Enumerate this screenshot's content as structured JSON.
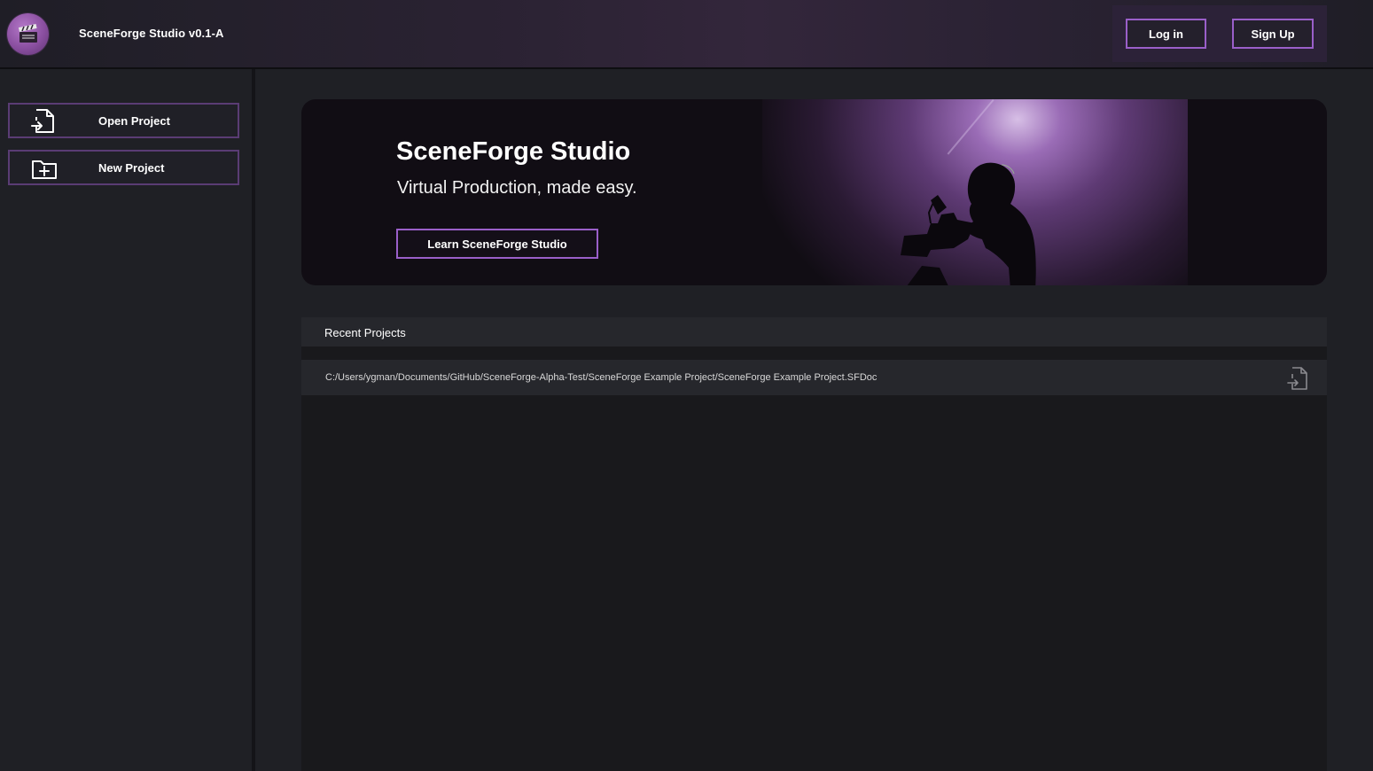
{
  "header": {
    "app_title": "SceneForge Studio v0.1-A",
    "logo_icon": "clapperboard-logo-icon",
    "login_label": "Log in",
    "signup_label": "Sign Up"
  },
  "sidebar": {
    "items": [
      {
        "label": "Open Project",
        "icon": "open-file-icon"
      },
      {
        "label": "New Project",
        "icon": "new-folder-icon"
      }
    ]
  },
  "hero": {
    "title": "SceneForge Studio",
    "subtitle": "Virtual Production, made easy.",
    "button_label": "Learn SceneForge Studio"
  },
  "recent": {
    "header": "Recent Projects",
    "items": [
      {
        "path": "C:/Users/ygman/Documents/GitHub/SceneForge-Alpha-Test/SceneForge Example Project/SceneForge Example Project.SFDoc",
        "icon": "open-file-icon"
      }
    ]
  },
  "colors": {
    "accent": "#9a5fc9",
    "background": "#1f2025",
    "panel": "#26272c"
  }
}
